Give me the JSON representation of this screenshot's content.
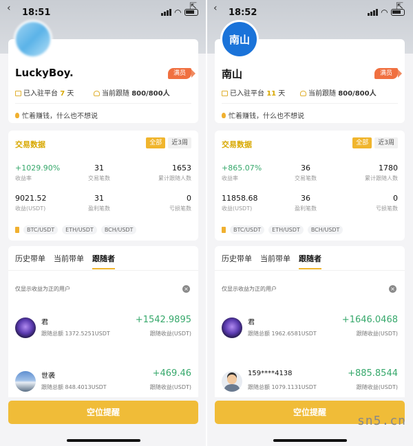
{
  "screens": [
    {
      "status": {
        "time": "18:51"
      },
      "profile": {
        "username": "LuckyBoy.",
        "avatar_text": "",
        "badge": "满员",
        "joined_prefix": "已入驻平台",
        "joined_days": "7",
        "joined_suffix": "天",
        "followers_prefix": "当前跟随",
        "followers": "800/800人",
        "motto": "忙着赚钱，什么也不想说"
      },
      "stats": {
        "title": "交易数据",
        "filter_all": "全部",
        "filter_recent": "近3周",
        "yield_value": "+1029.90%",
        "yield_label": "收益率",
        "trades_value": "31",
        "trades_label": "交易笔数",
        "total_followers_value": "1653",
        "total_followers_label": "累计跟随人数",
        "profit_value": "9021.52",
        "profit_label": "收益(USDT)",
        "win_value": "31",
        "win_label": "盈利笔数",
        "loss_value": "0",
        "loss_label": "亏损笔数",
        "pairs": [
          "BTC/USDT",
          "ETH/USDT",
          "BCH/USDT"
        ]
      },
      "follow": {
        "tabs": [
          "历史带单",
          "当前带单",
          "跟随者"
        ],
        "note": "仅显示收益为正的用户",
        "close_icon": "×",
        "followers": [
          {
            "name": "君",
            "amount": "跟随总额 1372.5251USDT",
            "profit": "+1542.9895",
            "profit_label": "跟随收益(USDT)"
          },
          {
            "name": "世袭",
            "amount": "跟随总额 848.4013USDT",
            "profit": "+469.46",
            "profit_label": "跟随收益(USDT)"
          }
        ]
      },
      "cta": "空位提醒"
    },
    {
      "status": {
        "time": "18:52"
      },
      "profile": {
        "username": "南山",
        "avatar_text": "南山",
        "badge": "满员",
        "joined_prefix": "已入驻平台",
        "joined_days": "11",
        "joined_suffix": "天",
        "followers_prefix": "当前跟随",
        "followers": "800/800人",
        "motto": "忙着赚钱，什么也不想说"
      },
      "stats": {
        "title": "交易数据",
        "filter_all": "全部",
        "filter_recent": "近3周",
        "yield_value": "+865.07%",
        "yield_label": "收益率",
        "trades_value": "36",
        "trades_label": "交易笔数",
        "total_followers_value": "1780",
        "total_followers_label": "累计跟随人数",
        "profit_value": "11858.68",
        "profit_label": "收益(USDT)",
        "win_value": "36",
        "win_label": "盈利笔数",
        "loss_value": "0",
        "loss_label": "亏损笔数",
        "pairs": [
          "BTC/USDT",
          "ETH/USDT",
          "BCH/USDT"
        ]
      },
      "follow": {
        "tabs": [
          "历史带单",
          "当前带单",
          "跟随者"
        ],
        "note": "仅显示收益为正的用户",
        "close_icon": "×",
        "followers": [
          {
            "name": "君",
            "amount": "跟随总额 1962.6581USDT",
            "profit": "+1646.0468",
            "profit_label": "跟随收益(USDT)"
          },
          {
            "name": "159****4138",
            "amount": "跟随总额 1079.1131USDT",
            "profit": "+885.8544",
            "profit_label": "跟随收益(USDT)"
          }
        ]
      },
      "cta": "空位提醒"
    }
  ],
  "watermark": "sn5.cn",
  "colors": {
    "accent": "#f0b52d",
    "positive": "#36a86b",
    "badge": "#f07040",
    "avatar_blue": "#1a73d9"
  }
}
